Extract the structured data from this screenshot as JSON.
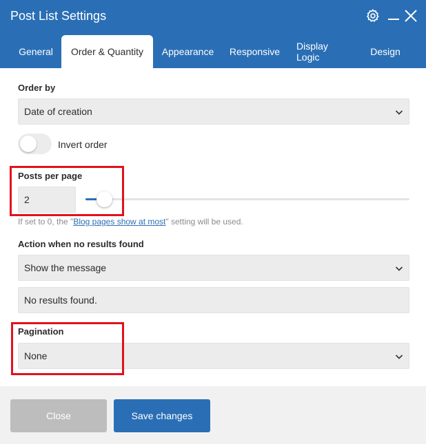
{
  "header": {
    "title": "Post List Settings",
    "icons": [
      "gear-icon",
      "minimize-icon",
      "close-icon"
    ]
  },
  "tabs": [
    {
      "label": "General",
      "active": false
    },
    {
      "label": "Order & Quantity",
      "active": true
    },
    {
      "label": "Appearance",
      "active": false
    },
    {
      "label": "Responsive",
      "active": false
    },
    {
      "label": "Display Logic",
      "active": false
    },
    {
      "label": "Design",
      "active": false
    }
  ],
  "order_by": {
    "label": "Order by",
    "value": "Date of creation"
  },
  "invert_order": {
    "label": "Invert order",
    "on": false
  },
  "posts_per_page": {
    "label": "Posts per page",
    "value": "2",
    "slider_fraction": 0.04,
    "hint_prefix": "If set to 0, the \"",
    "hint_link": "Blog pages show at most",
    "hint_suffix": "\" setting will be used."
  },
  "no_results": {
    "label": "Action when no results found",
    "value": "Show the message",
    "message": "No results found."
  },
  "pagination": {
    "label": "Pagination",
    "value": "None"
  },
  "footer": {
    "close_label": "Close",
    "save_label": "Save changes"
  },
  "colors": {
    "brand": "#2a6fb5",
    "highlight": "#e3101a",
    "disabled": "#bdbdbd"
  }
}
